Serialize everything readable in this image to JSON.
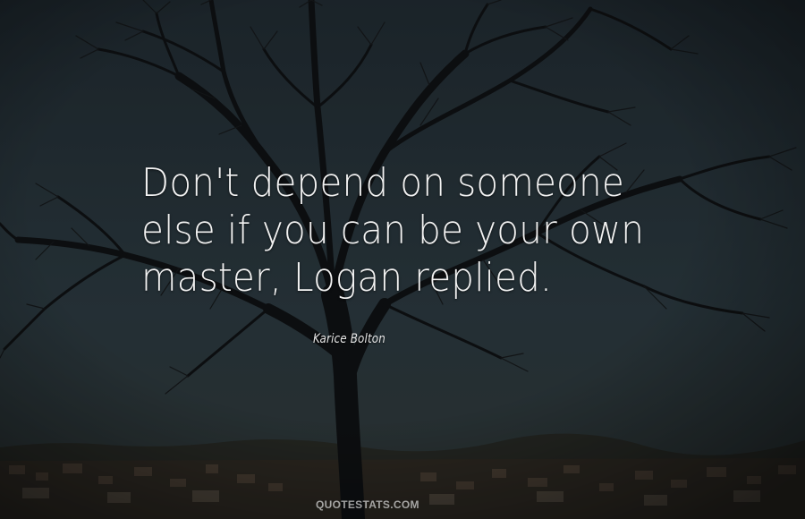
{
  "quote": {
    "lines": [
      "Don't depend on someone",
      "else if you can be your own",
      "master, Logan replied."
    ]
  },
  "author": "Karice Bolton",
  "watermark": "QUOTESTATS.COM",
  "colors": {
    "sky": "#263339",
    "text": "#f2f2f2",
    "tree": "#0e0f10",
    "town": "#3c3226"
  },
  "scene": {
    "elements": [
      "bare-tree",
      "town-skyline"
    ]
  }
}
